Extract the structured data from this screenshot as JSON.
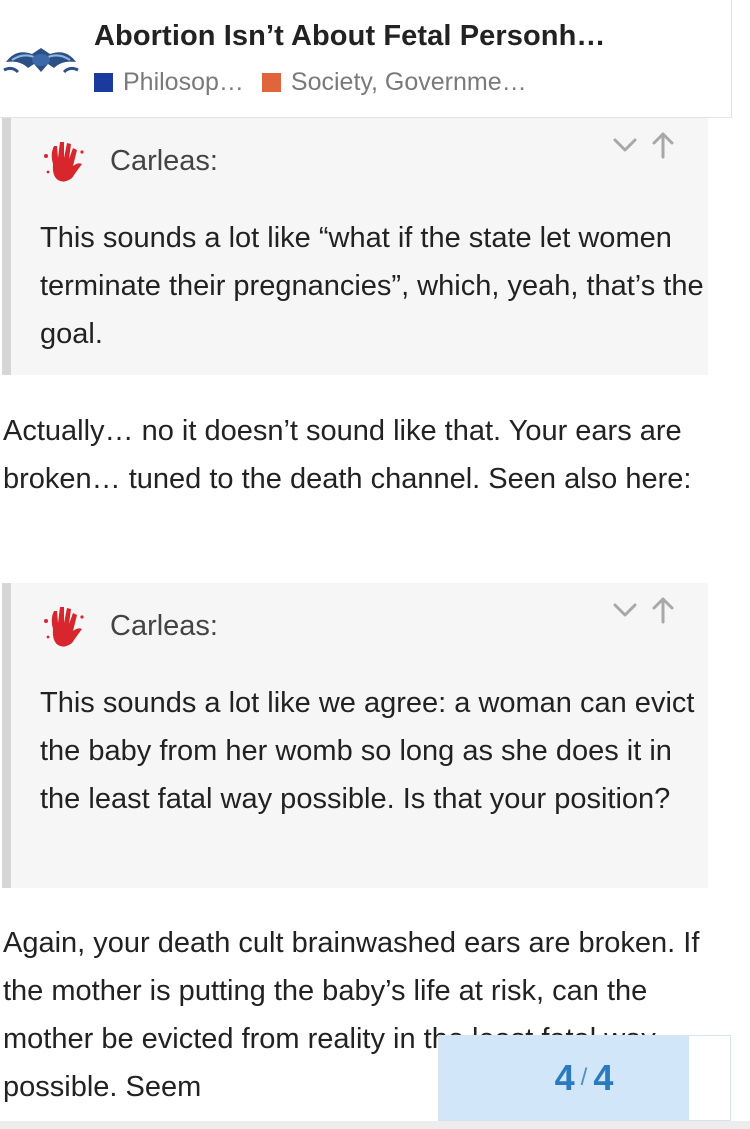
{
  "topic": {
    "title": "Abortion Isn’t About Fetal Personh…",
    "categories": [
      {
        "label": "Philosop…",
        "color": "#1a3a9e"
      },
      {
        "label": "Society, Governme…",
        "color": "#e0643c"
      }
    ]
  },
  "quotes": [
    {
      "author": "Carleas:",
      "text": "This sounds a lot like “what if the state let women terminate their pregnancies”, which, yeah, that’s the goal."
    },
    {
      "author": "Carleas:",
      "text": "This sounds a lot like we agree: a woman can evict the baby from her womb so long as she does it in the least fatal way possible. Is that your position?"
    }
  ],
  "paragraphs": [
    "Actually… no it doesn’t sound like that. Your ears are broken… tuned to the death channel. Seen also here:",
    "Again, your death cult brainwashed ears are broken. If the mother is putting the baby’s life at risk, can the mother be evicted from reality in the least fatal way possible. Seem"
  ],
  "timeline": {
    "current": "4",
    "separator": "/",
    "total": "4",
    "progress_fraction": 0.86
  },
  "colors": {
    "accent": "#2b7ac0",
    "progress_fill": "#d1e6f8",
    "quote_bg": "#f6f6f6",
    "quote_border": "#d6d6d6",
    "avatar_red": "#d7262c"
  },
  "icons": {
    "logo": "forum-logo-icon",
    "avatar": "red-handprint-icon",
    "expand": "chevron-down-icon",
    "jump": "arrow-up-icon"
  }
}
